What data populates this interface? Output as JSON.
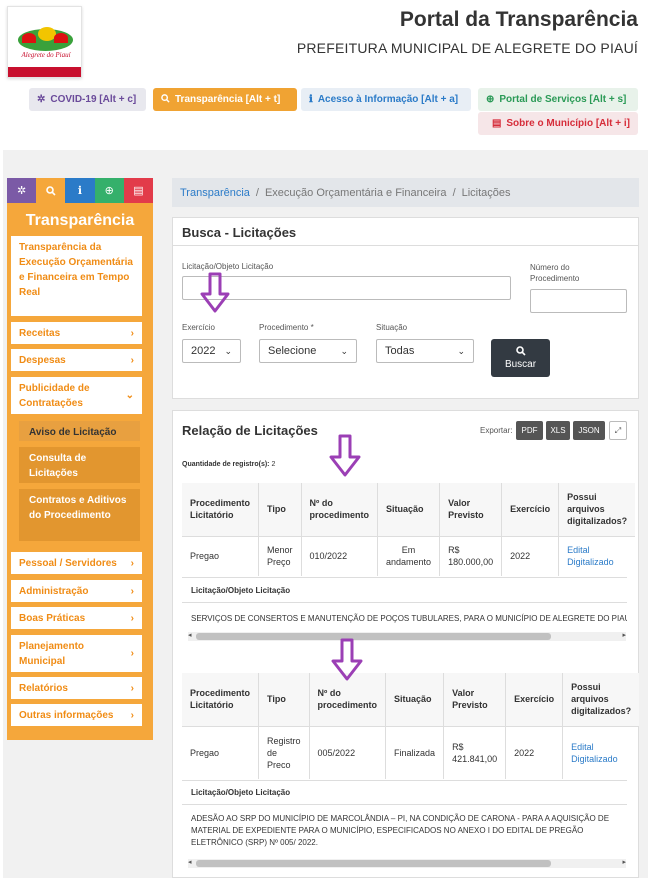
{
  "header": {
    "title": "Portal da Transparência",
    "subtitle": "PREFEITURA MUNICIPAL DE ALEGRETE DO PIAUÍ",
    "logo_text": "Alegrete do Piauí"
  },
  "topnav": {
    "covid": "COVID-19 [Alt + c]",
    "transparencia": "Transparência [Alt + t]",
    "acesso": "Acesso à Informação [Alt + a]",
    "servicos": "Portal de Serviços [Alt + s]",
    "sobre": "Sobre o Município [Alt + i]"
  },
  "sidebar": {
    "title": "Transparência",
    "items": [
      {
        "label": "Transparência da Execução Orçamentária e Financeira em Tempo Real"
      },
      {
        "label": "Receitas"
      },
      {
        "label": "Despesas"
      },
      {
        "label": "Publicidade de Contratações"
      },
      {
        "label": "Pessoal / Servidores"
      },
      {
        "label": "Administração"
      },
      {
        "label": "Boas Práticas"
      },
      {
        "label": "Planejamento Municipal"
      },
      {
        "label": "Relatórios"
      },
      {
        "label": "Outras informações"
      }
    ],
    "subitems": [
      {
        "label": "Aviso de Licitação"
      },
      {
        "label": "Consulta de Licitações"
      },
      {
        "label": "Contratos e Aditivos do Procedimento"
      }
    ]
  },
  "breadcrumb": {
    "home": "Transparência",
    "level2": "Execução Orçamentária e Financeira",
    "current": "Licitações",
    "sep": "/"
  },
  "search": {
    "title": "Busca - Licitações",
    "objeto_label": "Licitação/Objeto Licitação",
    "objeto_value": "",
    "numero_label": "Número do Procedimento",
    "numero_value": "",
    "exercicio_label": "Exercício",
    "exercicio_value": "2022",
    "procedimento_label": "Procedimento *",
    "procedimento_value": "Selecione",
    "situacao_label": "Situação",
    "situacao_value": "Todas",
    "button": "Buscar"
  },
  "results": {
    "title": "Relação de Licitações",
    "export_label": "Exportar:",
    "export": [
      "PDF",
      "XLS",
      "JSON"
    ],
    "quantity_label": "Quantidade de registro(s):",
    "quantity": "2",
    "columns": [
      "Procedimento Licitatório",
      "Tipo",
      "Nº do procedimento",
      "Situação",
      "Valor Previsto",
      "Exercício",
      "Possui arquivos digitalizados?"
    ],
    "object_label": "Licitação/Objeto Licitação",
    "rows": [
      {
        "procedimento": "Pregao",
        "tipo": "Menor Preço",
        "numero": "010/2022",
        "situacao": "Em andamento",
        "valor": "R$ 180.000,00",
        "exercicio": "2022",
        "arquivos": "Edital Digitalizado",
        "objeto": "SERVIÇOS DE CONSERTOS E MANUTENÇÃO DE POÇOS TUBULARES, PARA O MUNICÍPIO DE ALEGRETE DO PIAUÍ."
      },
      {
        "procedimento": "Pregao",
        "tipo": "Registro de Preco",
        "numero": "005/2022",
        "situacao": "Finalizada",
        "valor": "R$ 421.841,00",
        "exercicio": "2022",
        "arquivos": "Edital Digitalizado",
        "objeto": "ADESÃO AO SRP DO MUNICÍPIO DE MARCOLÂNDIA – PI, NA CONDIÇÃO DE CARONA - PARA A AQUISIÇÃO DE MATERIAL DE EXPEDIENTE PARA O MUNICÍPIO, ESPECIFICADOS NO ANEXO I DO EDITAL DE PREGÃO ELETRÔNICO (SRP) Nº 005/ 2022."
      }
    ]
  },
  "colors": {
    "orange": "#f5a73b",
    "annotation_arrow": "#9b3fb5",
    "link_blue": "#2b7bc8"
  }
}
